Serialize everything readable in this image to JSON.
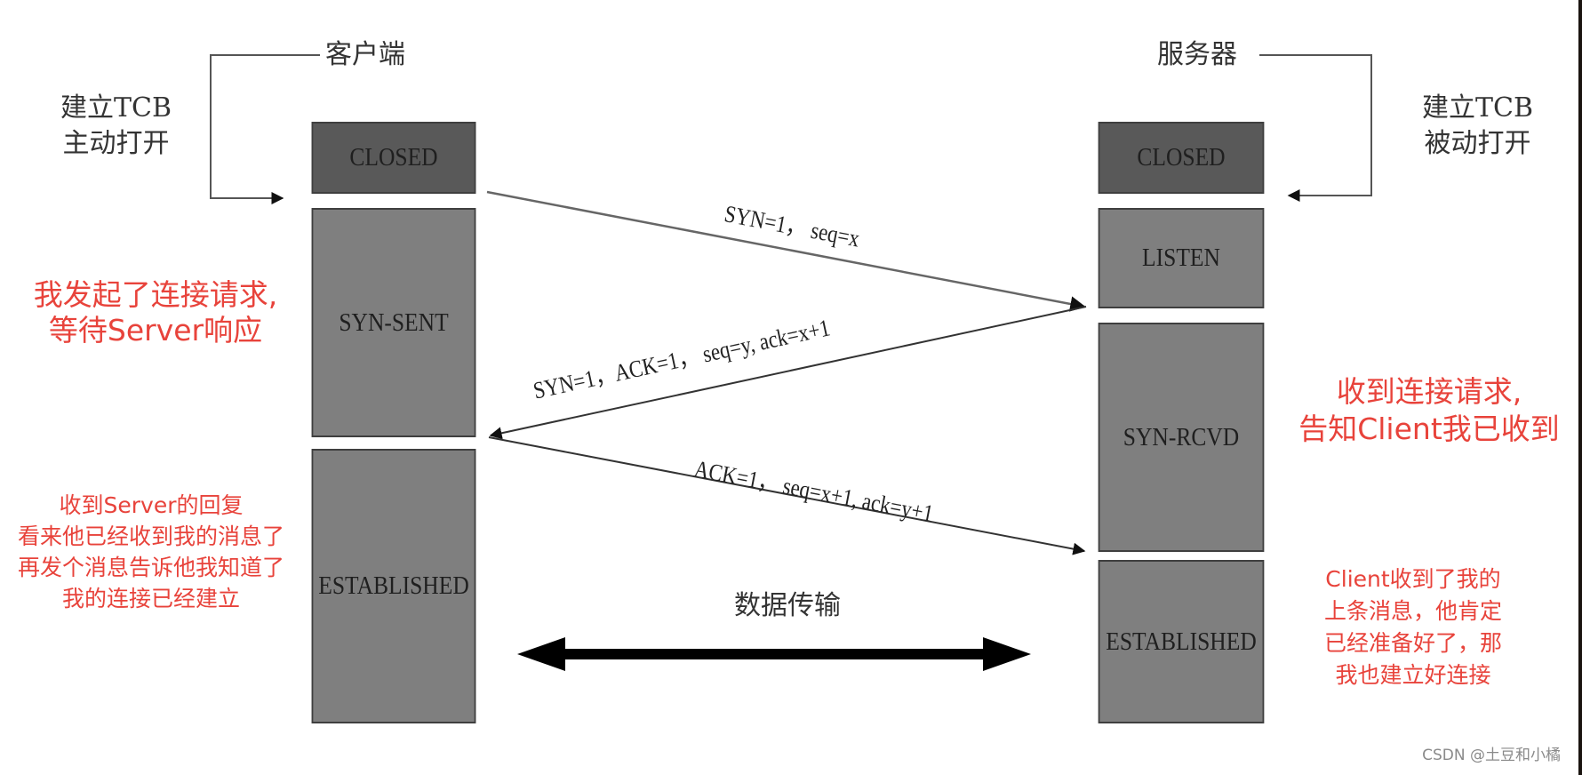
{
  "client": {
    "title": "客户端",
    "open_note": [
      "建立TCB",
      "主动打开"
    ],
    "states": [
      "CLOSED",
      "SYN-SENT",
      "ESTABLISHED"
    ]
  },
  "server": {
    "title": "服务器",
    "open_note": [
      "建立TCB",
      "被动打开"
    ],
    "states": [
      "CLOSED",
      "LISTEN",
      "SYN-RCVD",
      "ESTABLISHED"
    ]
  },
  "messages": [
    {
      "text": "SYN=1， seq=x",
      "direction": "client-to-server"
    },
    {
      "text": "SYN=1，ACK=1， seq=y, ack=x+1",
      "direction": "server-to-client"
    },
    {
      "text": "ACK=1， seq=x+1, ack=y+1",
      "direction": "client-to-server"
    }
  ],
  "data_transfer_label": "数据传输",
  "annotations": {
    "client_syn_sent": [
      "我发起了连接请求,",
      "等待Server响应"
    ],
    "client_established": [
      "收到Server的回复",
      "看来他已经收到我的消息了",
      "再发个消息告诉他我知道了",
      "我的连接已经建立"
    ],
    "server_syn_rcvd": [
      "收到连接请求,",
      "告知Client我已收到"
    ],
    "server_established": [
      "Client收到了我的",
      "上条消息，他肯定",
      "已经准备好了，那",
      "我也建立好连接"
    ]
  },
  "watermark": "CSDN @土豆和小橘",
  "colors": {
    "annotation": "#e8433b",
    "closed_box": "#595959",
    "state_box": "#7f7f7f"
  }
}
